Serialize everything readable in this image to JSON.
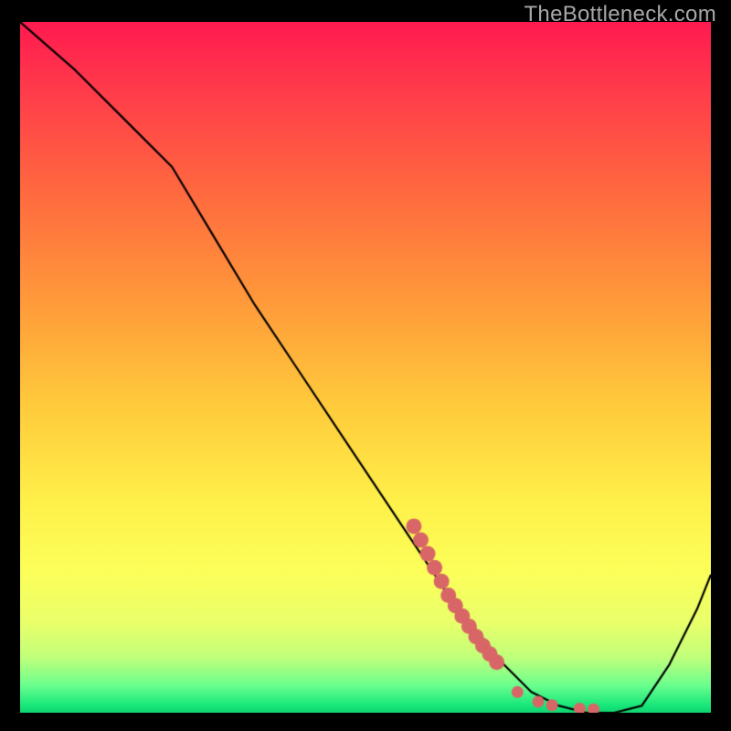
{
  "watermark": {
    "text": "TheBottleneck.com"
  },
  "chart_data": {
    "type": "line",
    "title": "",
    "xlabel": "",
    "ylabel": "",
    "xlim": [
      0,
      100
    ],
    "ylim": [
      0,
      100
    ],
    "grid": false,
    "legend": false,
    "series": [
      {
        "name": "curve",
        "color": "#000000",
        "x": [
          0,
          8,
          16,
          22,
          28,
          34,
          40,
          46,
          52,
          58,
          62,
          66,
          70,
          74,
          78,
          82,
          86,
          90,
          94,
          98,
          100
        ],
        "y": [
          100,
          93,
          85,
          79,
          69,
          59,
          50,
          41,
          32,
          23,
          17,
          12,
          7,
          3,
          1,
          0,
          0,
          1,
          7,
          15,
          20
        ]
      }
    ],
    "markers": {
      "name": "dots",
      "color": "#d86666",
      "stroke_points": [
        {
          "x": 57,
          "y": 27
        },
        {
          "x": 58,
          "y": 25
        },
        {
          "x": 59,
          "y": 23
        },
        {
          "x": 60,
          "y": 21
        },
        {
          "x": 61,
          "y": 19
        },
        {
          "x": 62,
          "y": 17
        },
        {
          "x": 63,
          "y": 15.5
        },
        {
          "x": 64,
          "y": 14
        },
        {
          "x": 65,
          "y": 12.5
        },
        {
          "x": 66,
          "y": 11
        },
        {
          "x": 67,
          "y": 9.7
        },
        {
          "x": 68,
          "y": 8.5
        },
        {
          "x": 69,
          "y": 7.3
        }
      ],
      "loose_points": [
        {
          "x": 72,
          "y": 3.0
        },
        {
          "x": 75,
          "y": 1.6
        },
        {
          "x": 77,
          "y": 1.1
        },
        {
          "x": 81,
          "y": 0.6
        },
        {
          "x": 83,
          "y": 0.5
        }
      ]
    },
    "background_gradient": {
      "top": "#ff1a50",
      "mid": "#fff14a",
      "bottom": "#0ed36f"
    }
  }
}
